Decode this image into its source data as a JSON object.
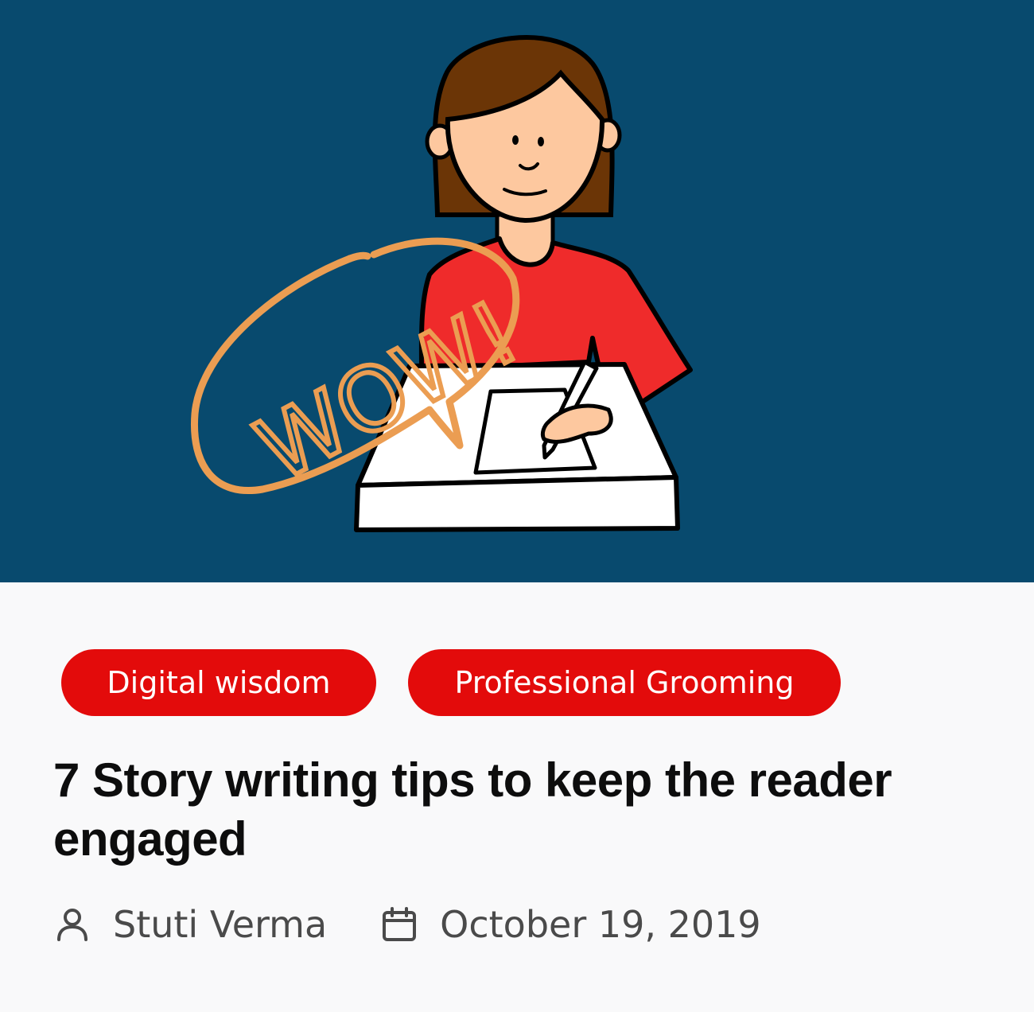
{
  "post": {
    "image_alt_icon": "woman-writing-illustration",
    "hero_bg_color": "#084a6e",
    "speech_bubble_text": "WOW!",
    "tags": [
      {
        "label": "Digital wisdom"
      },
      {
        "label": "Professional Grooming"
      }
    ],
    "tag_color": "#e30b0b",
    "title": "7 Story writing tips to keep the reader engaged",
    "author": "Stuti Verma",
    "date": "October 19, 2019",
    "author_icon": "user-icon",
    "date_icon": "calendar-icon"
  }
}
